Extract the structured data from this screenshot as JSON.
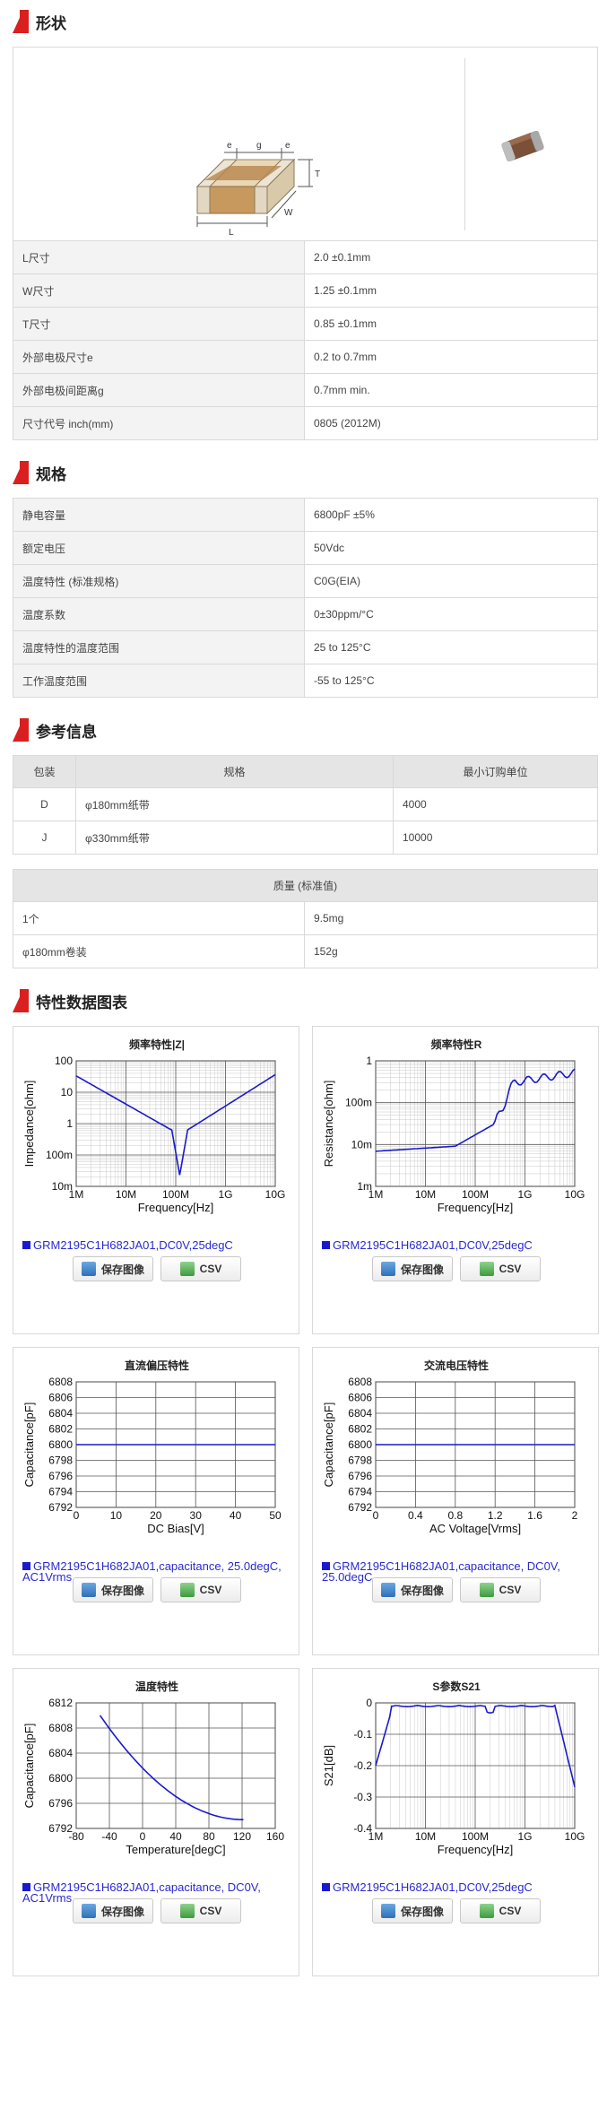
{
  "sections": {
    "shape": "形状",
    "spec": "规格",
    "reference": "参考信息",
    "charts": "特性数据图表"
  },
  "shape_dims": {
    "e": "e",
    "g": "g",
    "T": "T",
    "W": "W",
    "L": "L"
  },
  "shape_rows": [
    {
      "k": "L尺寸",
      "v": "2.0 ±0.1mm"
    },
    {
      "k": "W尺寸",
      "v": "1.25 ±0.1mm"
    },
    {
      "k": "T尺寸",
      "v": "0.85 ±0.1mm"
    },
    {
      "k": "外部电极尺寸e",
      "v": "0.2 to 0.7mm"
    },
    {
      "k": "外部电极间距离g",
      "v": "0.7mm min."
    },
    {
      "k": "尺寸代号 inch(mm)",
      "v": "0805 (2012M)"
    }
  ],
  "spec_rows": [
    {
      "k": "静电容量",
      "v": "6800pF ±5%"
    },
    {
      "k": "额定电压",
      "v": "50Vdc"
    },
    {
      "k": "温度特性 (标准规格)",
      "v": "C0G(EIA)"
    },
    {
      "k": "温度系数",
      "v": "0±30ppm/°C"
    },
    {
      "k": "温度特性的温度范围",
      "v": "25 to 125°C"
    },
    {
      "k": "工作温度范围",
      "v": "-55 to 125°C"
    }
  ],
  "packaging": {
    "headers": [
      "包装",
      "规格",
      "最小订购单位"
    ],
    "rows": [
      {
        "code": "D",
        "spec": "φ180mm纸带",
        "min": "4000"
      },
      {
        "code": "J",
        "spec": "φ330mm纸带",
        "min": "10000"
      }
    ]
  },
  "mass": {
    "header": "质量 (标准值)",
    "rows": [
      {
        "k": "1个",
        "v": "9.5mg"
      },
      {
        "k": "φ180mm卷装",
        "v": "152g"
      }
    ]
  },
  "buttons": {
    "save": "保存图像",
    "csv": "CSV"
  },
  "colors": {
    "accent": "#d9201f",
    "curve": "#1a1acc",
    "legend": "#2a2ad0"
  },
  "charts": [
    {
      "title": "频率特性|Z|",
      "xlabel": "Frequency[Hz]",
      "ylabel": "Impedance[ohm]",
      "legend": "GRM2195C1H682JA01,DC0V,25degC",
      "xticks": [
        "1M",
        "10M",
        "100M",
        "1G",
        "10G"
      ],
      "yticks": [
        "100",
        "10",
        "1",
        "100m",
        "10m"
      ]
    },
    {
      "title": "频率特性R",
      "xlabel": "Frequency[Hz]",
      "ylabel": "Resistance[ohm]",
      "legend": "GRM2195C1H682JA01,DC0V,25degC",
      "xticks": [
        "1M",
        "10M",
        "100M",
        "1G",
        "10G"
      ],
      "yticks": [
        "1",
        "100m",
        "10m",
        "1m"
      ]
    },
    {
      "title": "直流偏压特性",
      "xlabel": "DC Bias[V]",
      "ylabel": "Capacitance[pF]",
      "legend": "GRM2195C1H682JA01,capacitance, 25.0degC, AC1Vrms",
      "xticks": [
        "0",
        "10",
        "20",
        "30",
        "40",
        "50"
      ],
      "yticks": [
        "6808",
        "6806",
        "6804",
        "6802",
        "6800",
        "6798",
        "6796",
        "6794",
        "6792"
      ]
    },
    {
      "title": "交流电压特性",
      "xlabel": "AC Voltage[Vrms]",
      "ylabel": "Capacitance[pF]",
      "legend": "GRM2195C1H682JA01,capacitance, DC0V, 25.0degC",
      "xticks": [
        "0",
        "0.4",
        "0.8",
        "1.2",
        "1.6",
        "2"
      ],
      "yticks": [
        "6808",
        "6806",
        "6804",
        "6802",
        "6800",
        "6798",
        "6796",
        "6794",
        "6792"
      ]
    },
    {
      "title": "温度特性",
      "xlabel": "Temperature[degC]",
      "ylabel": "Capacitance[pF]",
      "legend": "GRM2195C1H682JA01,capacitance, DC0V, AC1Vrms",
      "xticks": [
        "-80",
        "-40",
        "0",
        "40",
        "80",
        "120",
        "160"
      ],
      "yticks": [
        "6812",
        "6808",
        "6804",
        "6800",
        "6796",
        "6792"
      ]
    },
    {
      "title": "S参数S21",
      "xlabel": "Frequency[Hz]",
      "ylabel": "S21[dB]",
      "legend": "GRM2195C1H682JA01,DC0V,25degC",
      "xticks": [
        "1M",
        "10M",
        "100M",
        "1G",
        "10G"
      ],
      "yticks": [
        "0",
        "-0.1",
        "-0.2",
        "-0.3",
        "-0.4"
      ]
    }
  ]
}
